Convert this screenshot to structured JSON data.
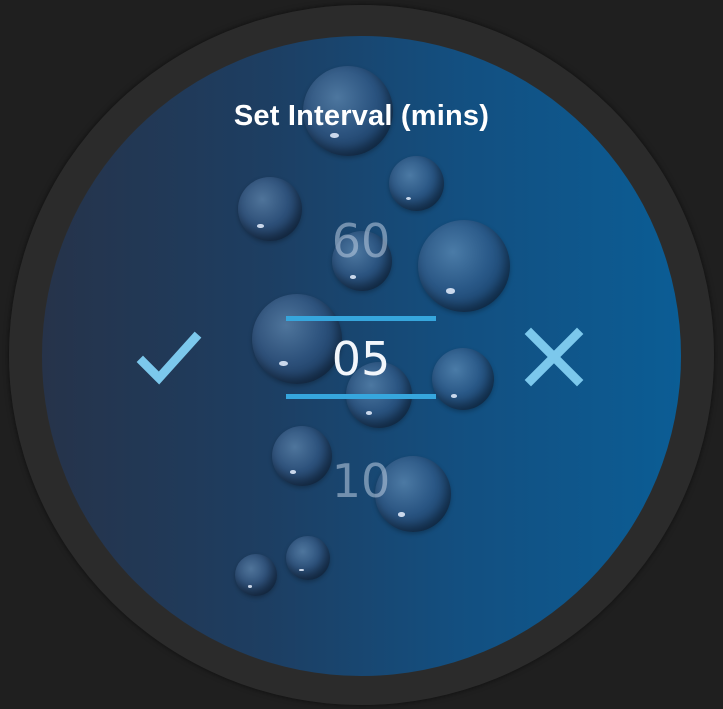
{
  "dialog": {
    "title": "Set Interval (mins)"
  },
  "picker": {
    "previous_value": "60",
    "selected_value": "05",
    "next_value": "10"
  },
  "actions": {
    "confirm_icon": "checkmark-icon",
    "cancel_icon": "close-icon"
  },
  "colors": {
    "accent": "#36a6dd",
    "icon": "#7cc8ec",
    "screen_left": "#26334a",
    "screen_right": "#0b5d95",
    "background": "#1f1f1f"
  }
}
